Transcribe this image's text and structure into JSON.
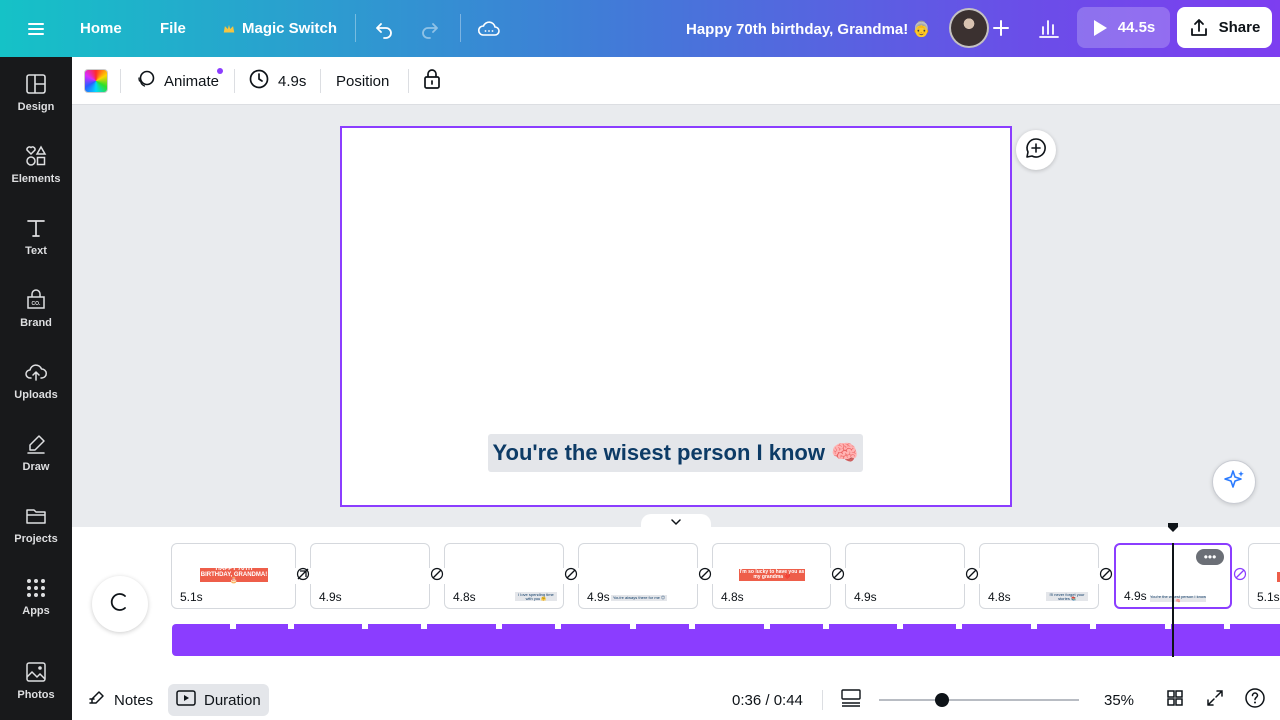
{
  "topbar": {
    "home": "Home",
    "file": "File",
    "magic_switch": "Magic Switch",
    "design_title": "Happy 70th birthday, Grandma! 👵",
    "play_duration": "44.5s",
    "share": "Share"
  },
  "sidebar": {
    "items": [
      {
        "label": "Design",
        "icon": "design-icon"
      },
      {
        "label": "Elements",
        "icon": "elements-icon"
      },
      {
        "label": "Text",
        "icon": "text-icon"
      },
      {
        "label": "Brand",
        "icon": "brand-icon"
      },
      {
        "label": "Uploads",
        "icon": "uploads-icon"
      },
      {
        "label": "Draw",
        "icon": "draw-icon"
      },
      {
        "label": "Projects",
        "icon": "projects-icon"
      },
      {
        "label": "Apps",
        "icon": "apps-icon"
      },
      {
        "label": "Photos",
        "icon": "photos-icon"
      }
    ]
  },
  "toolbar": {
    "animate": "Animate",
    "duration": "4.9s",
    "position": "Position"
  },
  "canvas": {
    "caption": "You're the wisest person I know 🧠"
  },
  "timeline": {
    "scenes": [
      {
        "duration": "5.1s",
        "thumb_text": "HAPPY 70TH BIRTHDAY, GRANDMA! 🎂",
        "thumb_style": "red"
      },
      {
        "duration": "4.9s",
        "thumb_text": "",
        "thumb_style": "grey"
      },
      {
        "duration": "4.8s",
        "thumb_text": "I love spending time with you 🤗",
        "thumb_style": "grey"
      },
      {
        "duration": "4.9s",
        "thumb_text": "You're always there for me 😊",
        "thumb_style": "grey"
      },
      {
        "duration": "4.8s",
        "thumb_text": "I'm so lucky to have you as my grandma ❤️",
        "thumb_style": "red"
      },
      {
        "duration": "4.9s",
        "thumb_text": "",
        "thumb_style": "grey"
      },
      {
        "duration": "4.8s",
        "thumb_text": "I'll never forget your stories 📚",
        "thumb_style": "grey"
      },
      {
        "duration": "4.9s",
        "thumb_text": "You're the wisest person I know 🧠",
        "thumb_style": "grey"
      },
      {
        "duration": "5.1s",
        "thumb_text": "",
        "thumb_style": "red"
      }
    ]
  },
  "bottombar": {
    "notes": "Notes",
    "duration": "Duration",
    "time": "0:36 / 0:44",
    "zoom": "35%"
  },
  "colors": {
    "accent": "#8b3dff",
    "sidebar_bg": "#18191b",
    "caption_text": "#0d3b66",
    "thumb_red": "#ee5e4a"
  }
}
